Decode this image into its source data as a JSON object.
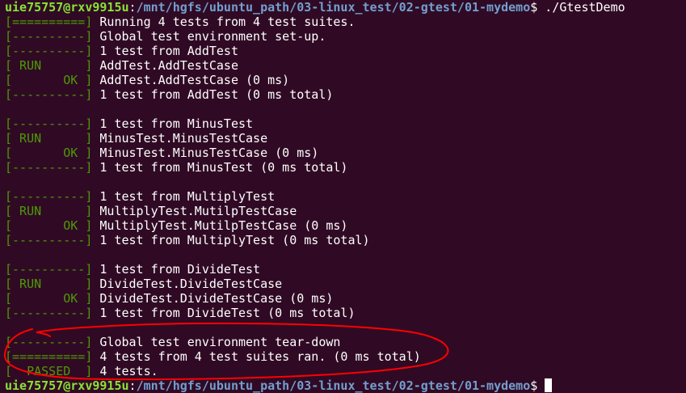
{
  "prompt": {
    "user_host": "uie75757@rxv9915u",
    "sep": ":",
    "path": "/mnt/hgfs/ubuntu_path/03-linux_test/02-gtest/01-mydemo",
    "dollar": "$",
    "command": " ./GtestDemo"
  },
  "lines": [
    {
      "tag": "[==========]",
      "text": " Running 4 tests from 4 test suites."
    },
    {
      "tag": "[----------]",
      "text": " Global test environment set-up."
    },
    {
      "tag": "[----------]",
      "text": " 1 test from AddTest"
    },
    {
      "tag": "[ RUN      ]",
      "text": " AddTest.AddTestCase"
    },
    {
      "tag": "[       OK ]",
      "text": " AddTest.AddTestCase (0 ms)"
    },
    {
      "tag": "[----------]",
      "text": " 1 test from AddTest (0 ms total)"
    },
    {
      "tag": "",
      "text": ""
    },
    {
      "tag": "[----------]",
      "text": " 1 test from MinusTest"
    },
    {
      "tag": "[ RUN      ]",
      "text": " MinusTest.MinusTestCase"
    },
    {
      "tag": "[       OK ]",
      "text": " MinusTest.MinusTestCase (0 ms)"
    },
    {
      "tag": "[----------]",
      "text": " 1 test from MinusTest (0 ms total)"
    },
    {
      "tag": "",
      "text": ""
    },
    {
      "tag": "[----------]",
      "text": " 1 test from MultiplyTest"
    },
    {
      "tag": "[ RUN      ]",
      "text": " MultiplyTest.MutilpTestCase"
    },
    {
      "tag": "[       OK ]",
      "text": " MultiplyTest.MutilpTestCase (0 ms)"
    },
    {
      "tag": "[----------]",
      "text": " 1 test from MultiplyTest (0 ms total)"
    },
    {
      "tag": "",
      "text": ""
    },
    {
      "tag": "[----------]",
      "text": " 1 test from DivideTest"
    },
    {
      "tag": "[ RUN      ]",
      "text": " DivideTest.DivideTestCase"
    },
    {
      "tag": "[       OK ]",
      "text": " DivideTest.DivideTestCase (0 ms)"
    },
    {
      "tag": "[----------]",
      "text": " 1 test from DivideTest (0 ms total)"
    },
    {
      "tag": "",
      "text": ""
    },
    {
      "tag": "[----------]",
      "text": " Global test environment tear-down"
    },
    {
      "tag": "[==========]",
      "text": " 4 tests from 4 test suites ran. (0 ms total)"
    },
    {
      "tag": "[  PASSED  ]",
      "text": " 4 tests."
    }
  ],
  "colors": {
    "background": "#300a24",
    "user_host": "#8ae234",
    "path": "#729fcf",
    "tag": "#4e9a06",
    "text": "#ffffff",
    "annotation": "#ff0000"
  }
}
